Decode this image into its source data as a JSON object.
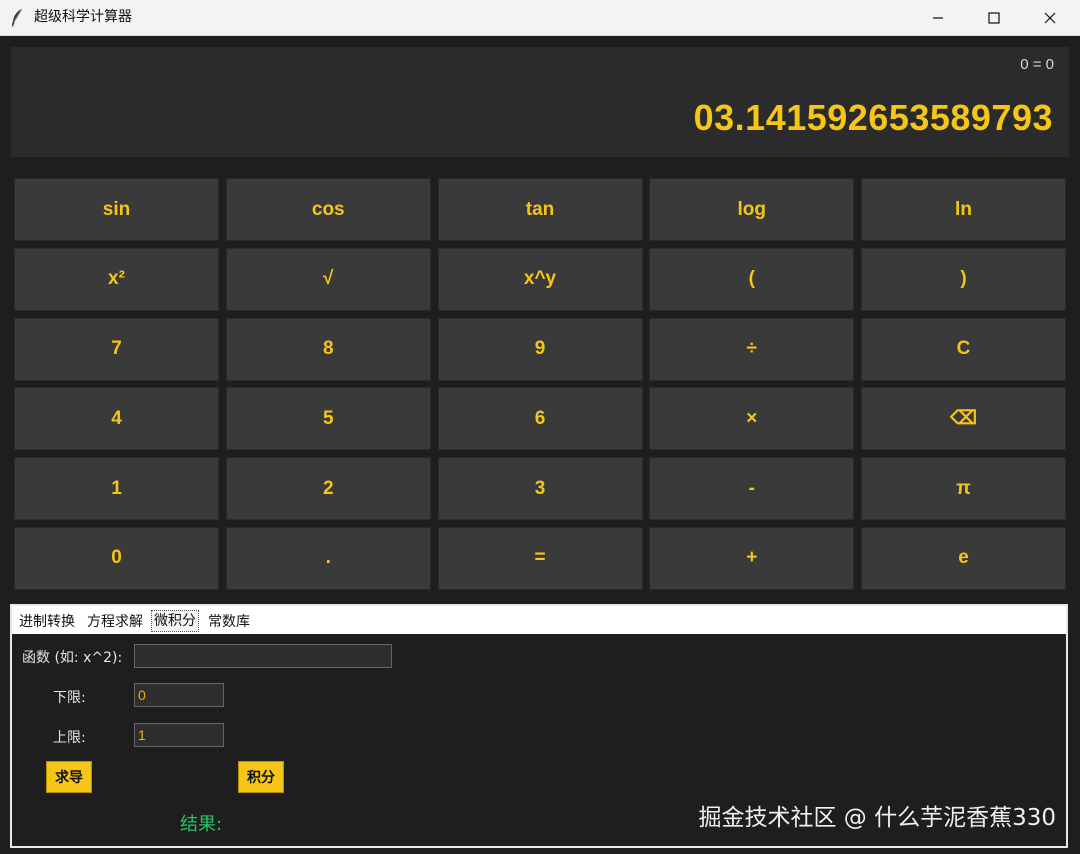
{
  "window": {
    "title": "超级科学计算器",
    "minimize_label": "—",
    "maximize_label": "☐",
    "close_label": "✕"
  },
  "display": {
    "expression": "0 = 0",
    "value": "03.141592653589793"
  },
  "keys": [
    "sin",
    "cos",
    "tan",
    "log",
    "ln",
    "x²",
    "√",
    "x^y",
    "(",
    ")",
    "7",
    "8",
    "9",
    "÷",
    "C",
    "4",
    "5",
    "6",
    "×",
    "⌫",
    "1",
    "2",
    "3",
    "-",
    "π",
    "0",
    ".",
    "=",
    "+",
    "e"
  ],
  "tabs": [
    "进制转换",
    "方程求解",
    "微积分",
    "常数库"
  ],
  "active_tab": 2,
  "calculus": {
    "function_label": "函数 (如: x^2):",
    "function_value": "",
    "lower_label": "下限:",
    "lower_value": "0",
    "upper_label": "上限:",
    "upper_value": "1",
    "derive_label": "求导",
    "integrate_label": "积分",
    "result_label": "结果:"
  },
  "watermark": "掘金技术社区 @ 什么芋泥香蕉330",
  "colors": {
    "accent": "#f5c518",
    "key_bg": "#3a3a3a",
    "background": "#1e1e1e",
    "result": "#22c55e"
  }
}
